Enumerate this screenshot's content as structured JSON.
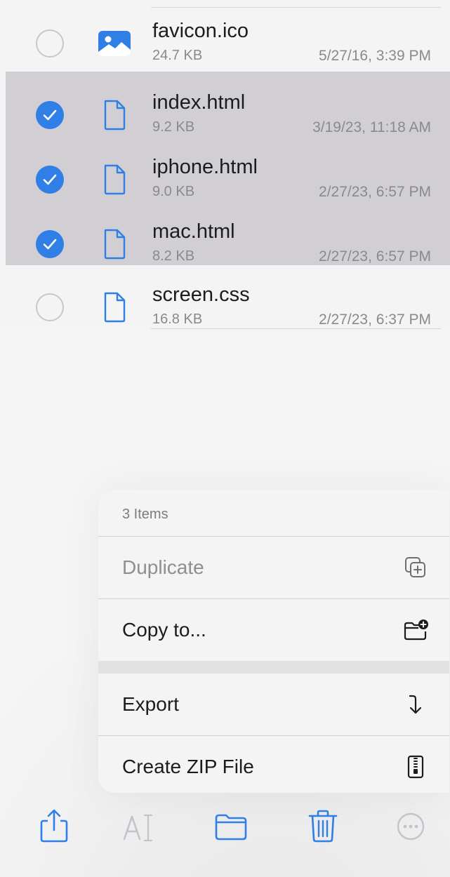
{
  "files": [
    {
      "name": "favicon.ico",
      "size": "24.7 KB",
      "date": "5/27/16, 3:39 PM",
      "selected": false,
      "icon": "image-file-icon"
    },
    {
      "name": "index.html",
      "size": "9.2 KB",
      "date": "3/19/23, 11:18 AM",
      "selected": true,
      "icon": "document-icon"
    },
    {
      "name": "iphone.html",
      "size": "9.0 KB",
      "date": "2/27/23, 6:57 PM",
      "selected": true,
      "icon": "document-icon"
    },
    {
      "name": "mac.html",
      "size": "8.2 KB",
      "date": "2/27/23, 6:57 PM",
      "selected": true,
      "icon": "document-icon"
    },
    {
      "name": "screen.css",
      "size": "16.8 KB",
      "date": "2/27/23, 6:37 PM",
      "selected": false,
      "icon": "document-icon"
    }
  ],
  "menu": {
    "header": "3 Items",
    "items": [
      {
        "label": "Duplicate",
        "icon": "duplicate-icon",
        "disabled": true
      },
      {
        "label": "Copy to...",
        "icon": "folder-add-icon",
        "disabled": false
      },
      {
        "label": "Export",
        "icon": "export-arrow-icon",
        "disabled": false
      },
      {
        "label": "Create ZIP File",
        "icon": "zip-file-icon",
        "disabled": false
      }
    ]
  },
  "toolbar": {
    "items": [
      {
        "name": "share-icon",
        "enabled": true
      },
      {
        "name": "rename-icon",
        "enabled": false
      },
      {
        "name": "folder-icon",
        "enabled": true
      },
      {
        "name": "trash-icon",
        "enabled": true
      },
      {
        "name": "more-icon",
        "enabled": false
      }
    ]
  },
  "colors": {
    "accent": "#2f7fe6",
    "selection": "#d2cfd4",
    "disabled": "#c0c4cc"
  }
}
